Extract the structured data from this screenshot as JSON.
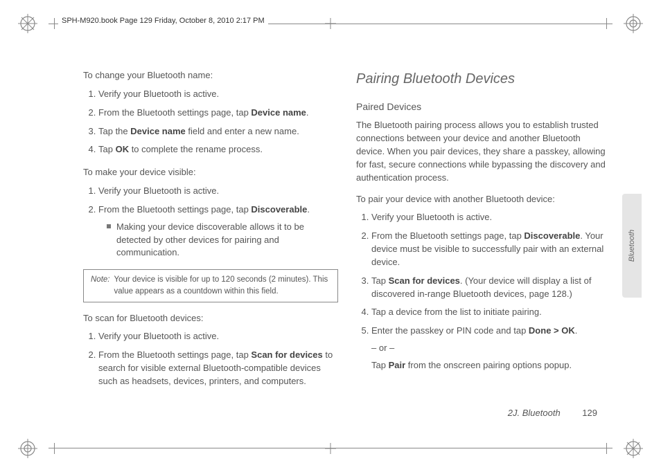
{
  "header_meta": "SPH-M920.book  Page 129  Friday, October 8, 2010  2:17 PM",
  "side_tab": "Bluetooth",
  "footer": {
    "section": "2J. Bluetooth",
    "page": "129"
  },
  "left": {
    "h_change_name": "To change your Bluetooth name:",
    "steps_change_name": {
      "s1": "Verify your Bluetooth is active.",
      "s2a": "From the Bluetooth settings page, tap ",
      "s2b": "Device name",
      "s2c": ".",
      "s3a": "Tap the ",
      "s3b": "Device name",
      "s3c": " field and enter a new name.",
      "s4a": "Tap ",
      "s4b": "OK",
      "s4c": " to complete the rename process."
    },
    "h_make_visible": "To make your device visible:",
    "steps_visible": {
      "s1": "Verify your Bluetooth is active.",
      "s2a": "From the Bluetooth settings page, tap ",
      "s2b": "Discoverable",
      "s2c": ".",
      "s2_bullet": "Making your device discoverable allows it to be detected by other devices for pairing and communication."
    },
    "note_label": "Note:",
    "note_body": "Your device is visible for up to 120 seconds (2 minutes). This value appears as a countdown within this field.",
    "h_scan": "To scan for Bluetooth devices:",
    "steps_scan": {
      "s1": "Verify your Bluetooth is active.",
      "s2a": "From the Bluetooth settings page, tap ",
      "s2b": "Scan for devices",
      "s2c": " to search for visible external Bluetooth-compatible devices such as headsets, devices, printers, and computers."
    }
  },
  "right": {
    "title": "Pairing Bluetooth Devices",
    "subtitle": "Paired Devices",
    "intro": "The Bluetooth pairing process allows you to establish trusted connections between your device and another Bluetooth device. When you pair devices, they share a passkey, allowing for fast, secure connections while bypassing the discovery and authentication process.",
    "h_pair": "To pair your device with another Bluetooth device:",
    "steps_pair": {
      "s1": "Verify your Bluetooth is active.",
      "s2a": "From the Bluetooth settings page, tap ",
      "s2b": "Discoverable",
      "s2c": ". Your device must be visible to successfully pair with an external device.",
      "s3a": "Tap ",
      "s3b": "Scan for devices",
      "s3c": ". (Your device will display a list of discovered in-range Bluetooth devices, page 128.)",
      "s4": "Tap a device from the list to initiate pairing.",
      "s5a": "Enter the passkey or PIN code and tap ",
      "s5b": "Done > OK",
      "s5c": ".",
      "s5_or": "– or –",
      "s5d_a": "Tap ",
      "s5d_b": "Pair",
      "s5d_c": " from the onscreen pairing options popup."
    }
  }
}
